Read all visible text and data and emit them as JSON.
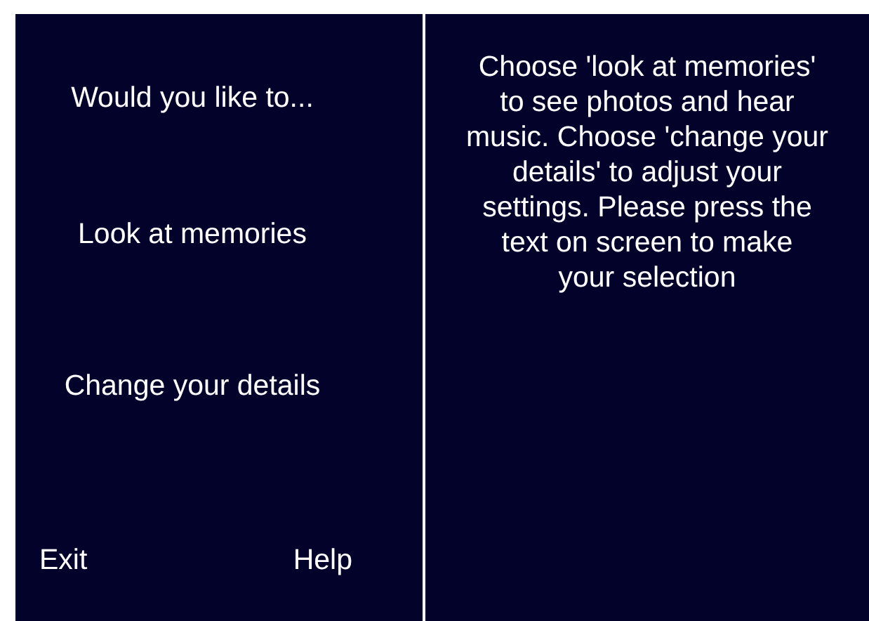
{
  "prompt": "Would you like to...",
  "options": [
    {
      "label": "Look at memories"
    },
    {
      "label": "Change your details"
    }
  ],
  "footer_buttons": [
    {
      "label": "Exit"
    },
    {
      "label": "Help"
    }
  ],
  "help_text_lines": [
    "Choose 'look at memories'",
    "to see photos and hear",
    "music. Choose 'change your",
    "details' to adjust your",
    "settings. Please press the",
    "text on screen to make",
    "your selection"
  ]
}
